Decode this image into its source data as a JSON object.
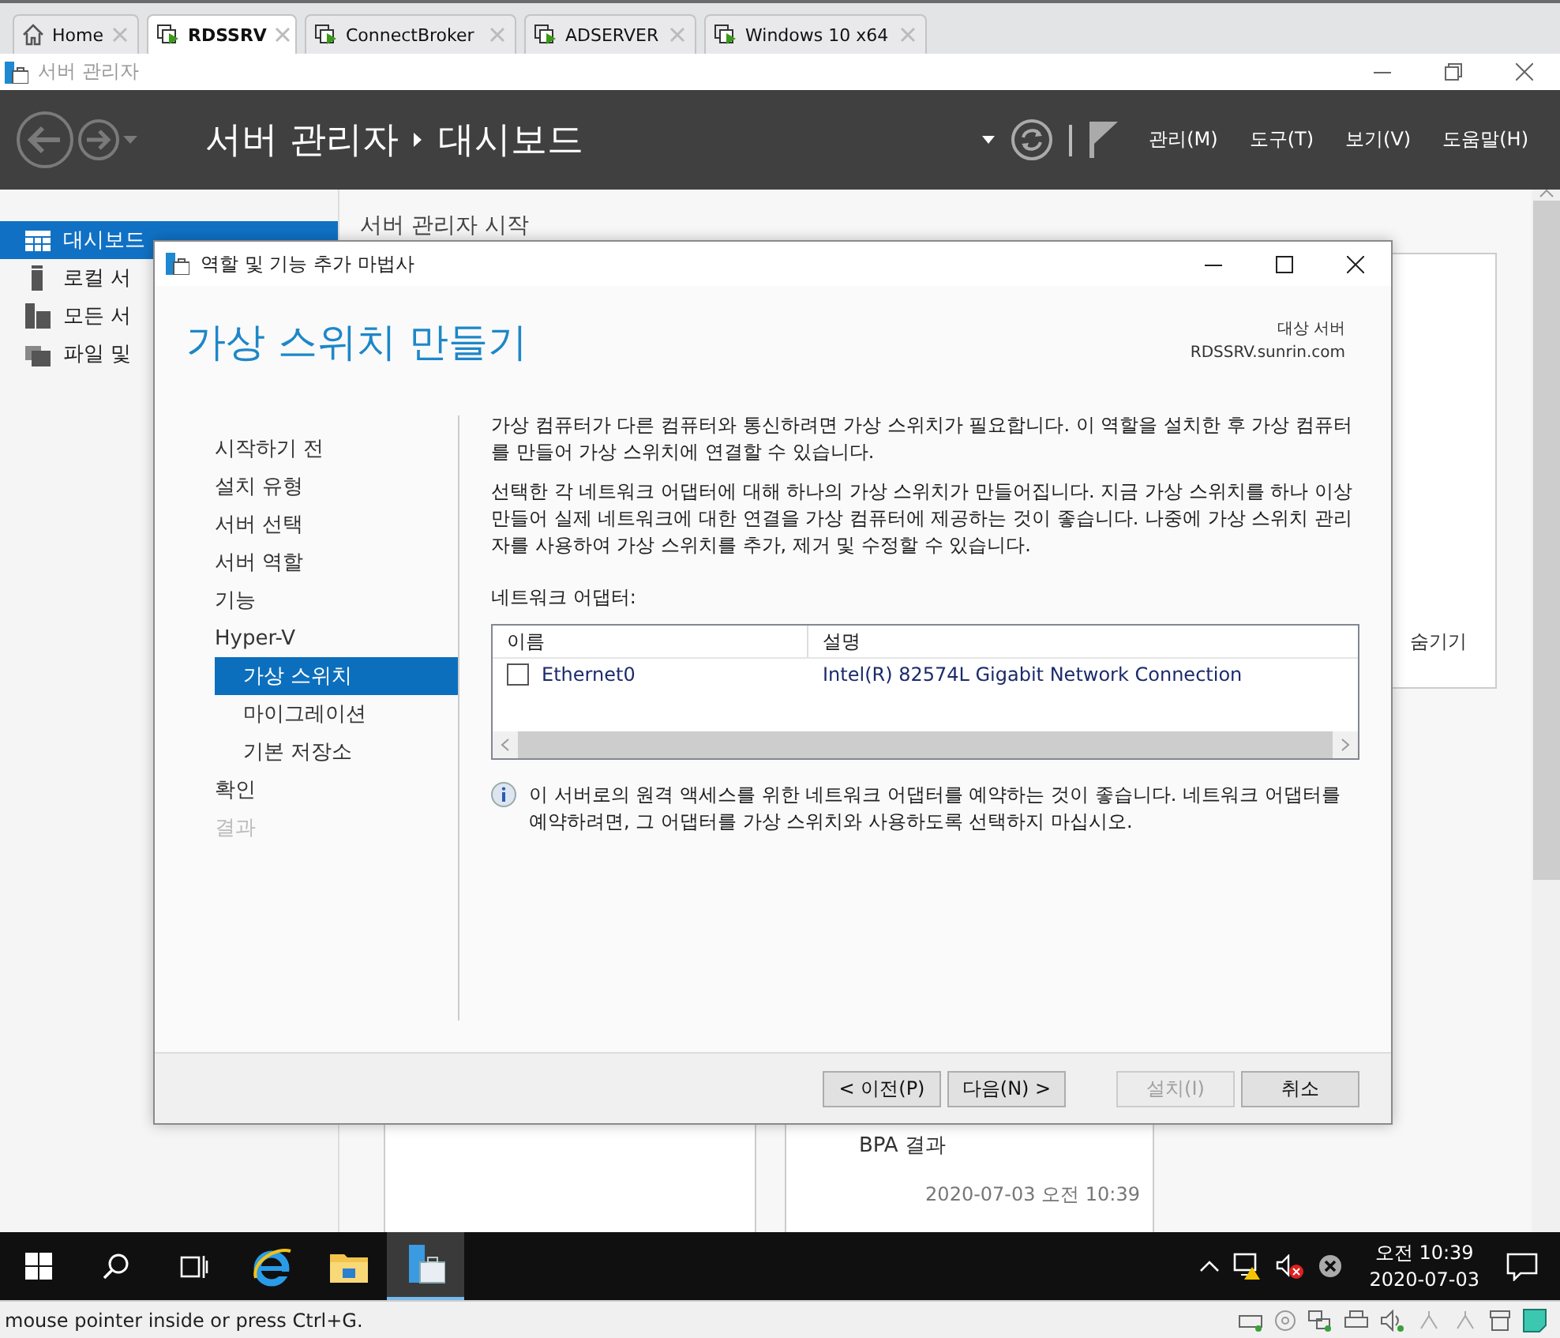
{
  "vm_tabs": [
    {
      "label": "Home",
      "kind": "home",
      "selected": false
    },
    {
      "label": "RDSSRV",
      "kind": "vm",
      "selected": true
    },
    {
      "label": "ConnectBroker",
      "kind": "vm",
      "selected": false
    },
    {
      "label": "ADSERVER",
      "kind": "vm",
      "selected": false
    },
    {
      "label": "Windows 10 x64",
      "kind": "vm",
      "selected": false
    }
  ],
  "window": {
    "title": "서버 관리자"
  },
  "header": {
    "breadcrumb": [
      "서버 관리자",
      "대시보드"
    ],
    "menus": [
      "관리(M)",
      "도구(T)",
      "보기(V)",
      "도움말(H)"
    ]
  },
  "sidebar": {
    "items": [
      {
        "label": "대시보드",
        "kind": "dashboard",
        "selected": true
      },
      {
        "label": "로컬 서",
        "kind": "local",
        "selected": false
      },
      {
        "label": "모든 서",
        "kind": "all",
        "selected": false
      },
      {
        "label": "파일 및",
        "kind": "files",
        "selected": false
      }
    ]
  },
  "dashboard": {
    "heading": "서버 관리자 시작",
    "hide_link": "숨기기",
    "bpa_label": "BPA 결과",
    "timestamp": "2020-07-03 오전 10:39"
  },
  "dialog": {
    "title": "역할 및 기능 추가 마법사",
    "page_title": "가상 스위치 만들기",
    "target_label": "대상 서버",
    "target_server": "RDSSRV.sunrin.com",
    "nav": [
      {
        "label": "시작하기 전",
        "selected": false,
        "disabled": false
      },
      {
        "label": "설치 유형",
        "selected": false,
        "disabled": false
      },
      {
        "label": "서버 선택",
        "selected": false,
        "disabled": false
      },
      {
        "label": "서버 역할",
        "selected": false,
        "disabled": false
      },
      {
        "label": "기능",
        "selected": false,
        "disabled": false
      },
      {
        "label": "Hyper-V",
        "selected": false,
        "disabled": false,
        "children": [
          {
            "label": "가상 스위치",
            "selected": true,
            "disabled": false
          },
          {
            "label": "마이그레이션",
            "selected": false,
            "disabled": false
          },
          {
            "label": "기본 저장소",
            "selected": false,
            "disabled": false
          }
        ]
      },
      {
        "label": "확인",
        "selected": false,
        "disabled": false
      },
      {
        "label": "결과",
        "selected": false,
        "disabled": true
      }
    ],
    "paragraphs": [
      "가상 컴퓨터가 다른 컴퓨터와 통신하려면 가상 스위치가 필요합니다. 이 역할을 설치한 후 가상 컴퓨터를 만들어 가상 스위치에 연결할 수 있습니다.",
      "선택한 각 네트워크 어댑터에 대해 하나의 가상 스위치가 만들어집니다. 지금 가상 스위치를 하나 이상 만들어 실제 네트워크에 대한 연결을 가상 컴퓨터에 제공하는 것이 좋습니다. 나중에 가상 스위치 관리자를 사용하여 가상 스위치를 추가, 제거 및 수정할 수 있습니다."
    ],
    "adapters_label": "네트워크 어댑터:",
    "adapter_table": {
      "columns": [
        "이름",
        "설명"
      ],
      "rows": [
        {
          "name": "Ethernet0",
          "description": "Intel(R) 82574L Gigabit Network Connection",
          "checked": false
        }
      ]
    },
    "note": "이 서버로의 원격 액세스를 위한 네트워크 어댑터를 예약하는 것이 좋습니다. 네트워크 어댑터를 예약하려면, 그 어댑터를 가상 스위치와 사용하도록 선택하지 마십시오.",
    "buttons": [
      {
        "label": "< 이전(P)",
        "disabled": false
      },
      {
        "label": "다음(N) >",
        "disabled": false
      },
      {
        "label": "설치(I)",
        "disabled": true
      },
      {
        "label": "취소",
        "disabled": false
      }
    ]
  },
  "taskbar": {
    "apps": [
      {
        "kind": "start",
        "selected": false
      },
      {
        "kind": "search",
        "selected": false
      },
      {
        "kind": "taskview",
        "selected": false
      },
      {
        "kind": "browser",
        "selected": false
      },
      {
        "kind": "explorer",
        "selected": false
      },
      {
        "kind": "servermanager",
        "selected": true
      }
    ],
    "clock": {
      "time": "오전 10:39",
      "date": "2020-07-03"
    }
  },
  "status_bar": {
    "text": "mouse pointer inside or press Ctrl+G."
  }
}
